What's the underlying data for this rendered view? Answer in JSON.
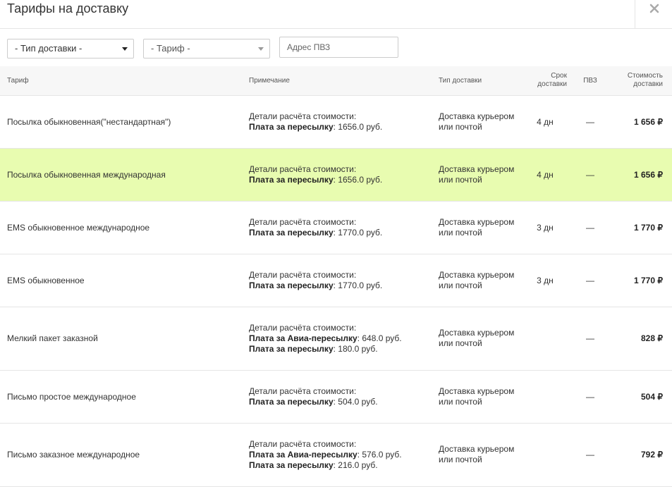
{
  "header": {
    "title": "Тарифы на доставку",
    "close_icon": "close-icon"
  },
  "filters": {
    "delivery_type": {
      "value": "- Тип доставки -"
    },
    "tariff": {
      "value": "- Тариф -"
    },
    "address": {
      "placeholder": "Адрес ПВЗ",
      "value": ""
    }
  },
  "table": {
    "columns": {
      "tariff": "Тариф",
      "note": "Примечание",
      "delivery_type": "Тип доставки",
      "term_1": "Срок",
      "term_2": "доставки",
      "pvz": "ПВЗ",
      "cost_1": "Стоимость",
      "cost_2": "доставки"
    },
    "rows": [
      {
        "name": "Посылка обыкновенная(\"нестандартная\")",
        "note_title": "Детали расчёта стоимости:",
        "note_lines": [
          {
            "label": "Плата за пересылку",
            "value": ": 1656.0 руб."
          }
        ],
        "delivery_type": "Доставка курьером или почтой",
        "days": "4 дн",
        "pvz": "—",
        "price": "1 656 ₽",
        "highlighted": false
      },
      {
        "name": "Посылка обыкновенная международная",
        "note_title": "Детали расчёта стоимости:",
        "note_lines": [
          {
            "label": "Плата за пересылку",
            "value": ": 1656.0 руб."
          }
        ],
        "delivery_type": "Доставка курьером или почтой",
        "days": "4 дн",
        "pvz": "—",
        "price": "1 656 ₽",
        "highlighted": true
      },
      {
        "name": "EMS обыкновенное международное",
        "note_title": "Детали расчёта стоимости:",
        "note_lines": [
          {
            "label": "Плата за пересылку",
            "value": ": 1770.0 руб."
          }
        ],
        "delivery_type": "Доставка курьером или почтой",
        "days": "3 дн",
        "pvz": "—",
        "price": "1 770 ₽",
        "highlighted": false
      },
      {
        "name": "EMS обыкновенное",
        "note_title": "Детали расчёта стоимости:",
        "note_lines": [
          {
            "label": "Плата за пересылку",
            "value": ": 1770.0 руб."
          }
        ],
        "delivery_type": "Доставка курьером или почтой",
        "days": "3 дн",
        "pvz": "—",
        "price": "1 770 ₽",
        "highlighted": false
      },
      {
        "name": "Мелкий пакет заказной",
        "note_title": "Детали расчёта стоимости:",
        "note_lines": [
          {
            "label": "Плата за Авиа-пересылку",
            "value": ": 648.0 руб."
          },
          {
            "label": "Плата за пересылку",
            "value": ": 180.0 руб."
          }
        ],
        "delivery_type": "Доставка курьером или почтой",
        "days": "",
        "pvz": "—",
        "price": "828 ₽",
        "highlighted": false
      },
      {
        "name": "Письмо простое международное",
        "note_title": "Детали расчёта стоимости:",
        "note_lines": [
          {
            "label": "Плата за пересылку",
            "value": ": 504.0 руб."
          }
        ],
        "delivery_type": "Доставка курьером или почтой",
        "days": "",
        "pvz": "—",
        "price": "504 ₽",
        "highlighted": false
      },
      {
        "name": "Письмо заказное международное",
        "note_title": "Детали расчёта стоимости:",
        "note_lines": [
          {
            "label": "Плата за Авиа-пересылку",
            "value": ": 576.0 руб."
          },
          {
            "label": "Плата за пересылку",
            "value": ": 216.0 руб."
          }
        ],
        "delivery_type": "Доставка курьером или почтой",
        "days": "",
        "pvz": "—",
        "price": "792 ₽",
        "highlighted": false
      }
    ]
  },
  "colors": {
    "highlight": "#e8fcb0",
    "border": "#e5e5e5",
    "header_bg": "#f7f7f7"
  }
}
